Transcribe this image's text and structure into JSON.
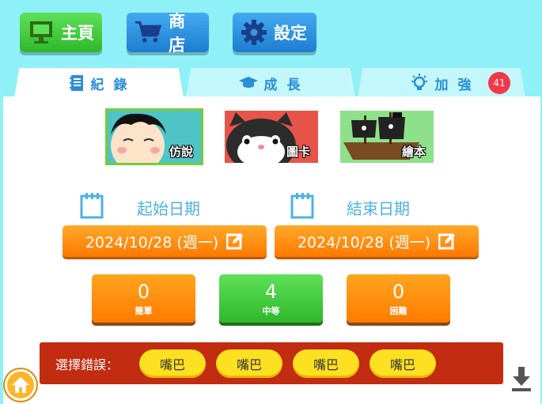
{
  "topnav": {
    "home_label": "主頁",
    "shop_label": "商店",
    "settings_label": "設定"
  },
  "tabs": {
    "records": "紀 錄",
    "growth": "成 長",
    "boost": "加 強",
    "boost_badge": "41"
  },
  "categories": [
    {
      "label": "仿說"
    },
    {
      "label": "圖卡"
    },
    {
      "label": "繪本"
    }
  ],
  "dates": {
    "start_label": "起始日期",
    "end_label": "結束日期",
    "start_value": "2024/10/28 (週一)",
    "end_value": "2024/10/28 (週一)"
  },
  "stats": {
    "easy": {
      "value": "0",
      "label": "簡單"
    },
    "medium": {
      "value": "4",
      "label": "中等"
    },
    "hard": {
      "value": "0",
      "label": "困難"
    }
  },
  "errors": {
    "label": "選擇錯誤：",
    "items": [
      "嘴巴",
      "嘴巴",
      "嘴巴",
      "嘴巴"
    ]
  },
  "colors": {
    "background": "#8ff0f8",
    "accent_blue": "#2a8fd8",
    "orange": "#ff7800",
    "green": "#2fb82a",
    "error_bar": "#c22c10",
    "pill_yellow": "#fde021"
  }
}
